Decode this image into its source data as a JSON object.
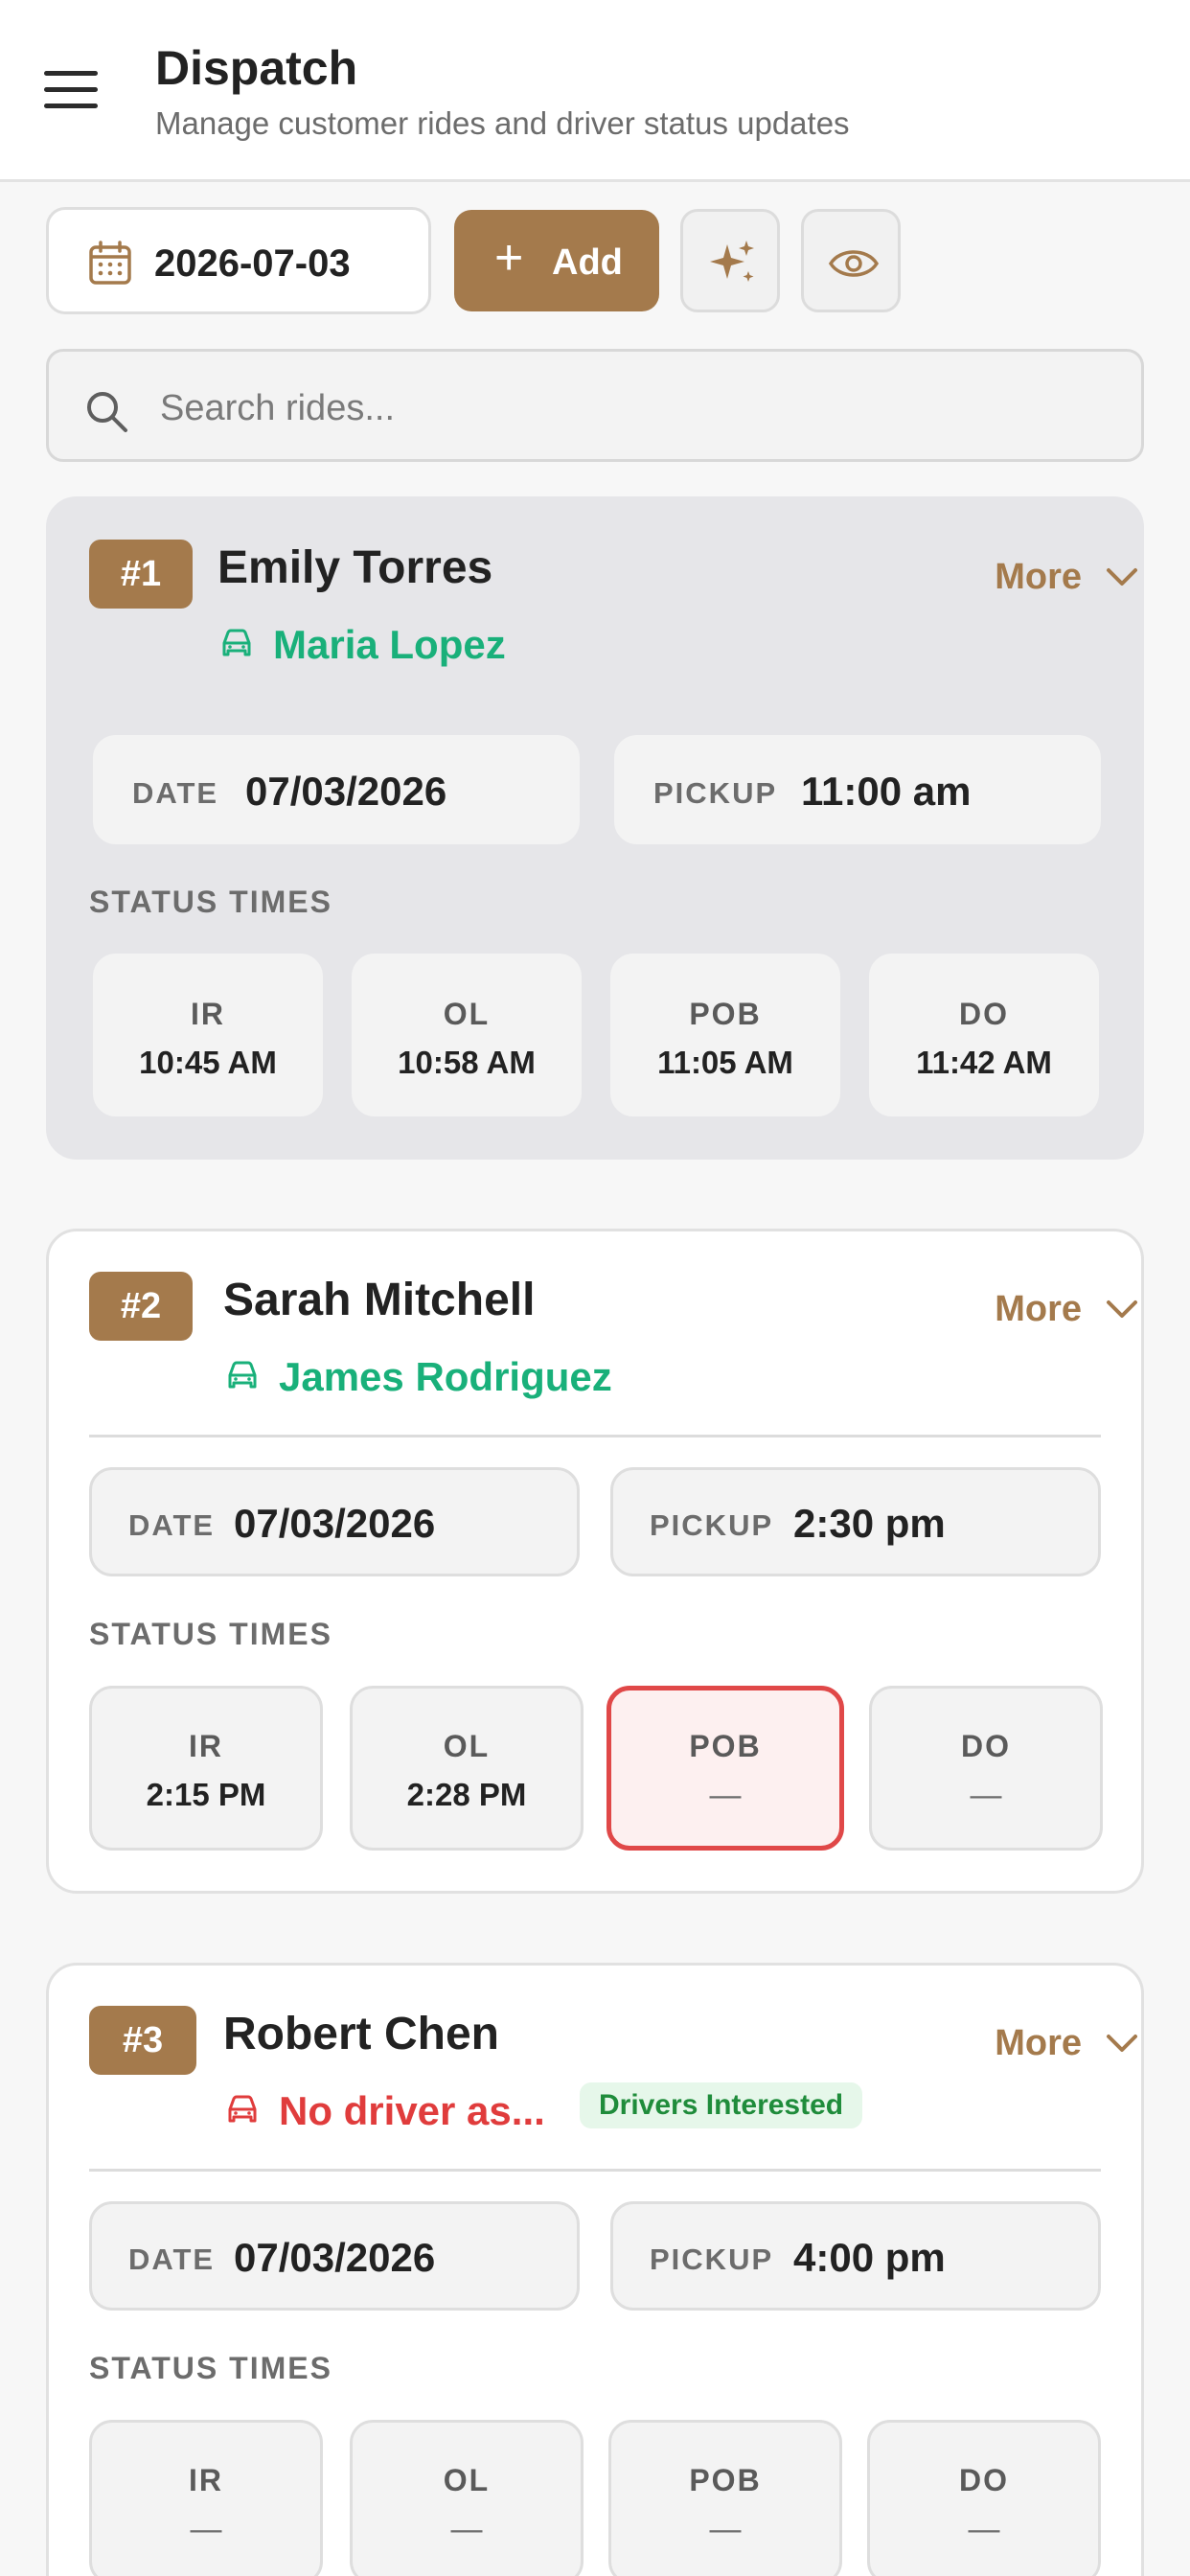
{
  "header": {
    "title": "Dispatch",
    "subtitle": "Manage customer rides and driver status updates"
  },
  "toolbar": {
    "date": "2026-07-03",
    "add_label": "Add",
    "icons": [
      "calendar-icon",
      "plus-icon",
      "sparkles-icon",
      "eye-icon"
    ]
  },
  "search": {
    "placeholder": "Search rides..."
  },
  "labels": {
    "more": "More",
    "date": "DATE",
    "pickup": "PICKUP",
    "status_times": "STATUS TIMES",
    "ir": "IR",
    "ol": "OL",
    "pob": "POB",
    "do": "DO"
  },
  "rides": [
    {
      "badge": "#1",
      "rider": "Emily Torres",
      "driver": "Maria Lopez",
      "date": "07/03/2026",
      "pickup": "11:00 am",
      "ir": "10:45 AM",
      "ol": "10:58 AM",
      "pob": "11:05 AM",
      "do": "11:42 AM"
    },
    {
      "badge": "#2",
      "rider": "Sarah Mitchell",
      "driver": "James Rodriguez",
      "date": "07/03/2026",
      "pickup": "2:30 pm",
      "ir": "2:15 PM",
      "ol": "2:28 PM",
      "pob": "—",
      "do": "—"
    },
    {
      "badge": "#3",
      "rider": "Robert Chen",
      "driver": "No driver as...",
      "interest": "Drivers Interested",
      "date": "07/03/2026",
      "pickup": "4:00 pm",
      "ir": "—",
      "ol": "—",
      "pob": "—",
      "do": "—"
    }
  ],
  "colors": {
    "accent": "#a47a4c",
    "driver_assigned": "#19b07a",
    "driver_missing": "#e03c3c",
    "alert_border": "#e04848"
  }
}
